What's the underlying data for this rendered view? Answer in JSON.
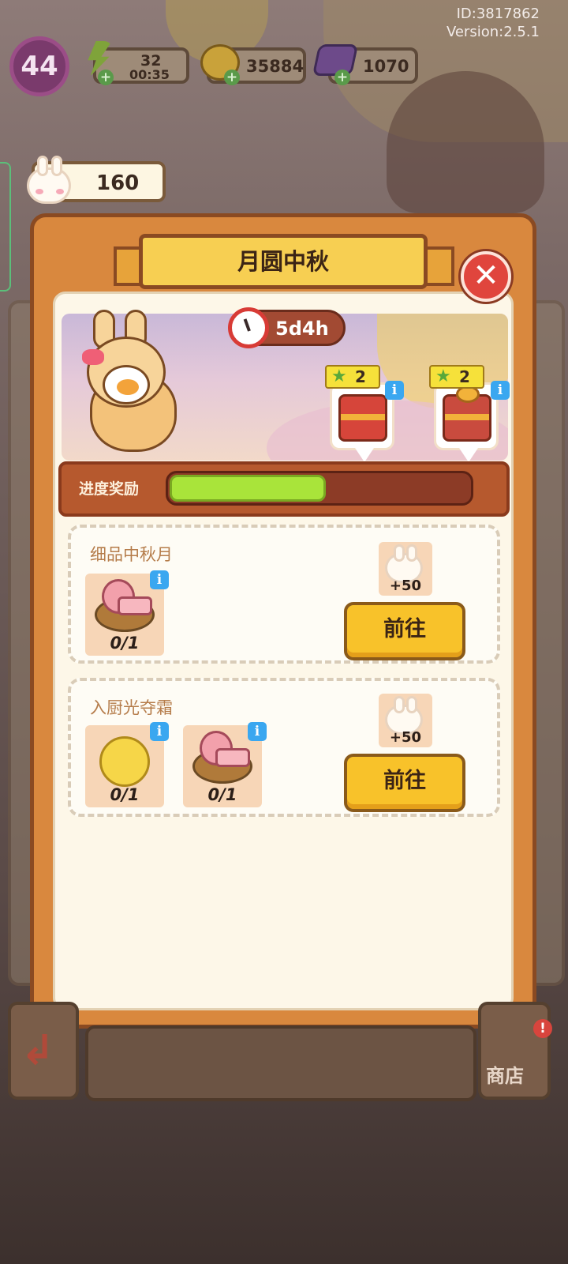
{
  "meta": {
    "id_label": "ID:3817862",
    "version_label": "Version:2.5.1"
  },
  "hud": {
    "level": "44",
    "energy": {
      "value": "32",
      "timer": "00:35"
    },
    "coins": "35884",
    "gems": "1070",
    "carrots": "160"
  },
  "dialog": {
    "title": "月圆中秋",
    "close_symbol": "✕",
    "timer": "5d4h",
    "chests": [
      {
        "badge": "2",
        "icon": "red-chest-icon"
      },
      {
        "badge": "2",
        "icon": "gift-chest-icon"
      }
    ],
    "progress": {
      "label": "进度奖励",
      "fraction": 0.52
    },
    "tasks": [
      {
        "title": "细品中秋月",
        "items": [
          {
            "icon": "mooncake-plate-icon",
            "count": "0/1"
          }
        ],
        "reward": "+50",
        "button": "前往"
      },
      {
        "title": "入厨光夺霜",
        "items": [
          {
            "icon": "golden-coin-icon",
            "count": "0/1"
          },
          {
            "icon": "mooncake-plate-icon",
            "count": "0/1"
          }
        ],
        "reward": "+50",
        "button": "前往"
      }
    ]
  },
  "footer": {
    "shop_label": "商店",
    "alert": "!"
  },
  "colors": {
    "accent": "#f8c22a",
    "dialog": "#d9883e",
    "progress_fill": "#a9e43a",
    "info": "#3aa7f0"
  }
}
